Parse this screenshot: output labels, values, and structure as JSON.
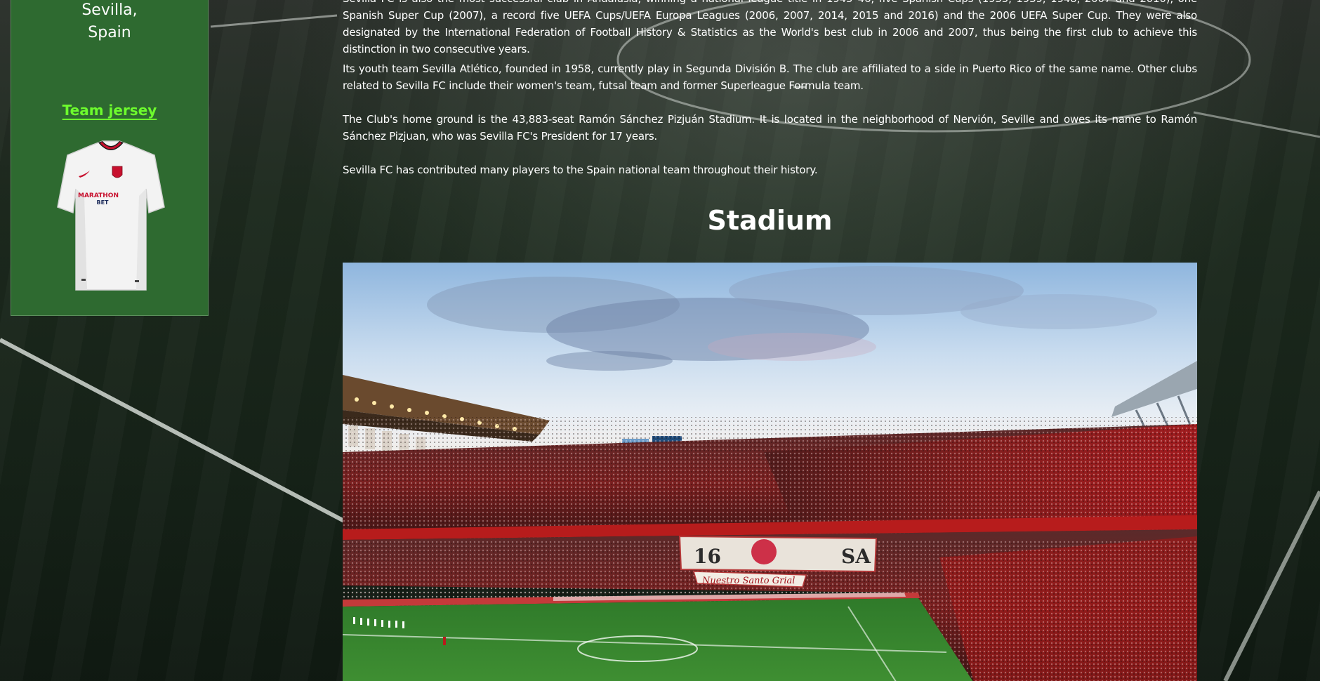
{
  "sidebar": {
    "city_line1": "Sevilla,",
    "city_line2": "Spain",
    "jersey_title": "Team jersey",
    "jersey_sponsor_line1": "MARATHON",
    "jersey_sponsor_line2": "BET"
  },
  "main": {
    "paragraphs": [
      "Sevilla FC is also the most successful club in Andalusia, winning a national league title in 1945–46, five Spanish Cups (1935, 1939, 1948, 2007 and 2010), one Spanish Super Cup (2007), a record five UEFA Cups/UEFA Europa Leagues (2006, 2007, 2014, 2015 and 2016) and the 2006 UEFA Super Cup. They were also designated by the International Federation of Football History & Statistics as the World's best club in 2006 and 2007, thus being the first club to achieve this distinction in two consecutive years.",
      "Its youth team Sevilla Atlético, founded in 1958, currently play in Segunda División B. The club are affiliated to a side in Puerto Rico of the same name. Other clubs related to Sevilla FC include their women's team, futsal team and former Superleague Formula team.",
      "The Club's home ground is the 43,883-seat Ramón Sánchez Pizjuán Stadium. It is located in the neighborhood of Nervión, Seville and owes its name to Ramón Sánchez Pizjuan, who was Sevilla FC's President for 17 years.",
      "Sevilla FC has contributed many players to the Spain national team throughout their history."
    ],
    "stadium_title": "Stadium",
    "banner_text_left": "16",
    "banner_text_right": "SA",
    "banner_caption": "Nuestro Santo Grial"
  }
}
